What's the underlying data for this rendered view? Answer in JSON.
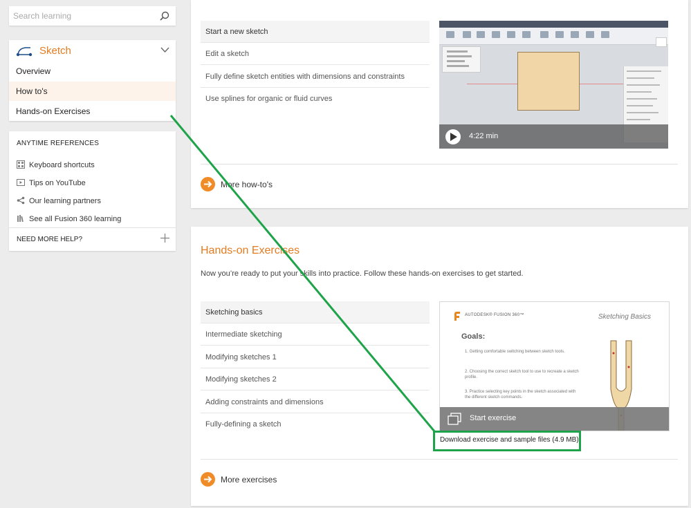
{
  "search": {
    "placeholder": "Search learning",
    "icon": "magnifier-icon"
  },
  "nav": {
    "title": "Sketch",
    "items": [
      {
        "label": "Overview",
        "active": false
      },
      {
        "label": "How to's",
        "active": true
      },
      {
        "label": "Hands-on Exercises",
        "active": false
      }
    ]
  },
  "references": {
    "header": "ANYTIME REFERENCES",
    "items": [
      {
        "label": "Keyboard shortcuts",
        "icon": "keyboard-icon"
      },
      {
        "label": "Tips on YouTube",
        "icon": "video-icon"
      },
      {
        "label": "Our learning partners",
        "icon": "share-icon"
      },
      {
        "label": "See all Fusion 360 learning",
        "icon": "books-icon"
      }
    ],
    "help_label": "NEED MORE HELP?"
  },
  "howto": {
    "items": [
      {
        "label": "Start a new sketch",
        "active": true
      },
      {
        "label": "Edit a sketch",
        "active": false
      },
      {
        "label": "Fully define sketch entities with dimensions and constraints",
        "active": false
      },
      {
        "label": "Use splines for organic or fluid curves",
        "active": false
      }
    ],
    "video_duration": "4:22 min",
    "more_label": "More how-to's"
  },
  "exercises": {
    "title": "Hands-on Exercises",
    "description": "Now you’re ready to put your skills into practice.  Follow these hands-on exercises to get started.",
    "items": [
      {
        "label": "Sketching basics",
        "active": true
      },
      {
        "label": "Intermediate sketching",
        "active": false
      },
      {
        "label": "Modifying sketches 1",
        "active": false
      },
      {
        "label": "Modifying sketches 2",
        "active": false
      },
      {
        "label": "Adding constraints and dimensions",
        "active": false
      },
      {
        "label": "Fully-defining a sketch",
        "active": false
      }
    ],
    "thumb": {
      "brand": "AUTODESK® FUSION 360™",
      "slide_title": "Sketching Basics",
      "goals_title": "Goals:",
      "goals": [
        "1. Getting comfortable switching between sketch tools.",
        "2. Choosing the correct sketch tool to use to recreate a sketch profile.",
        "3. Practice selecting key points in the sketch associated with the different sketch commands."
      ],
      "start_label": "Start exercise"
    },
    "download_label": "Download exercise and sample files (4.9 MB)",
    "more_label": "More exercises"
  },
  "colors": {
    "accent": "#e47b20",
    "highlight": "#1fa34a"
  }
}
